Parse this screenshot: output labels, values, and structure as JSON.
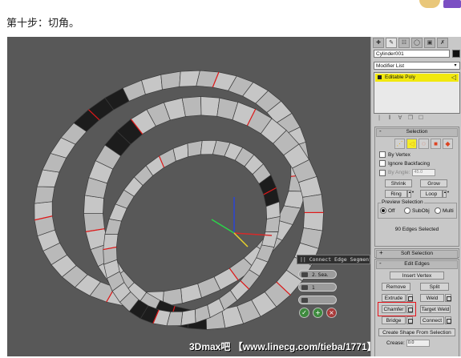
{
  "caption": "第十步：切角。",
  "watermark": "3Dmax吧 【www.linecg.com/tieba/1771】",
  "caddy": {
    "title": "|| Connect Edge Segments",
    "segments": "2. Sea.",
    "pinch": "1",
    "ok_icon": "check-icon",
    "apply_icon": "plus-icon",
    "cancel_icon": "x-icon"
  },
  "panel": {
    "tab_icons": [
      "create-icon",
      "modify-icon",
      "hierarchy-icon",
      "motion-icon",
      "display-icon",
      "utilities-icon"
    ],
    "object_name": "Cylinder001",
    "object_color": "#111111",
    "modifier_list": "Modifier List",
    "modifier_list_arrow": "▾",
    "stack_item": "Editable Poly",
    "stack_tools": [
      "|",
      "‖",
      "∀",
      "❒",
      "☐"
    ],
    "selection": {
      "header": "Selection",
      "toggle": "-",
      "by_vertex": "By Vertex",
      "ignore_backfacing": "Ignore Backfacing",
      "by_angle": "By Angle:",
      "by_angle_value": "45.0",
      "shrink": "Shrink",
      "grow": "Grow",
      "ring": "Ring",
      "loop": "Loop",
      "preview_selection": "Preview Selection",
      "preview_off": "Off",
      "preview_subobj": "SubObj",
      "preview_multi": "Multi",
      "status": "90 Edges Selected"
    },
    "soft_selection": {
      "header": "Soft Selection",
      "toggle": "+"
    },
    "edit_edges": {
      "header": "Edit Edges",
      "toggle": "-",
      "insert_vertex": "Insert Vertex",
      "remove": "Remove",
      "split": "Split",
      "extrude": "Extrude",
      "weld": "Weld",
      "chamfer": "Chamfer",
      "target_weld": "Target Weld",
      "bridge": "Bridge",
      "connect": "Connect",
      "create_shape": "Create Shape From Selection",
      "crease": "Crease:",
      "crease_value": "0.0"
    }
  },
  "colors": {
    "highlight": "#e8141b",
    "stack_yellow": "#f1e80f"
  }
}
